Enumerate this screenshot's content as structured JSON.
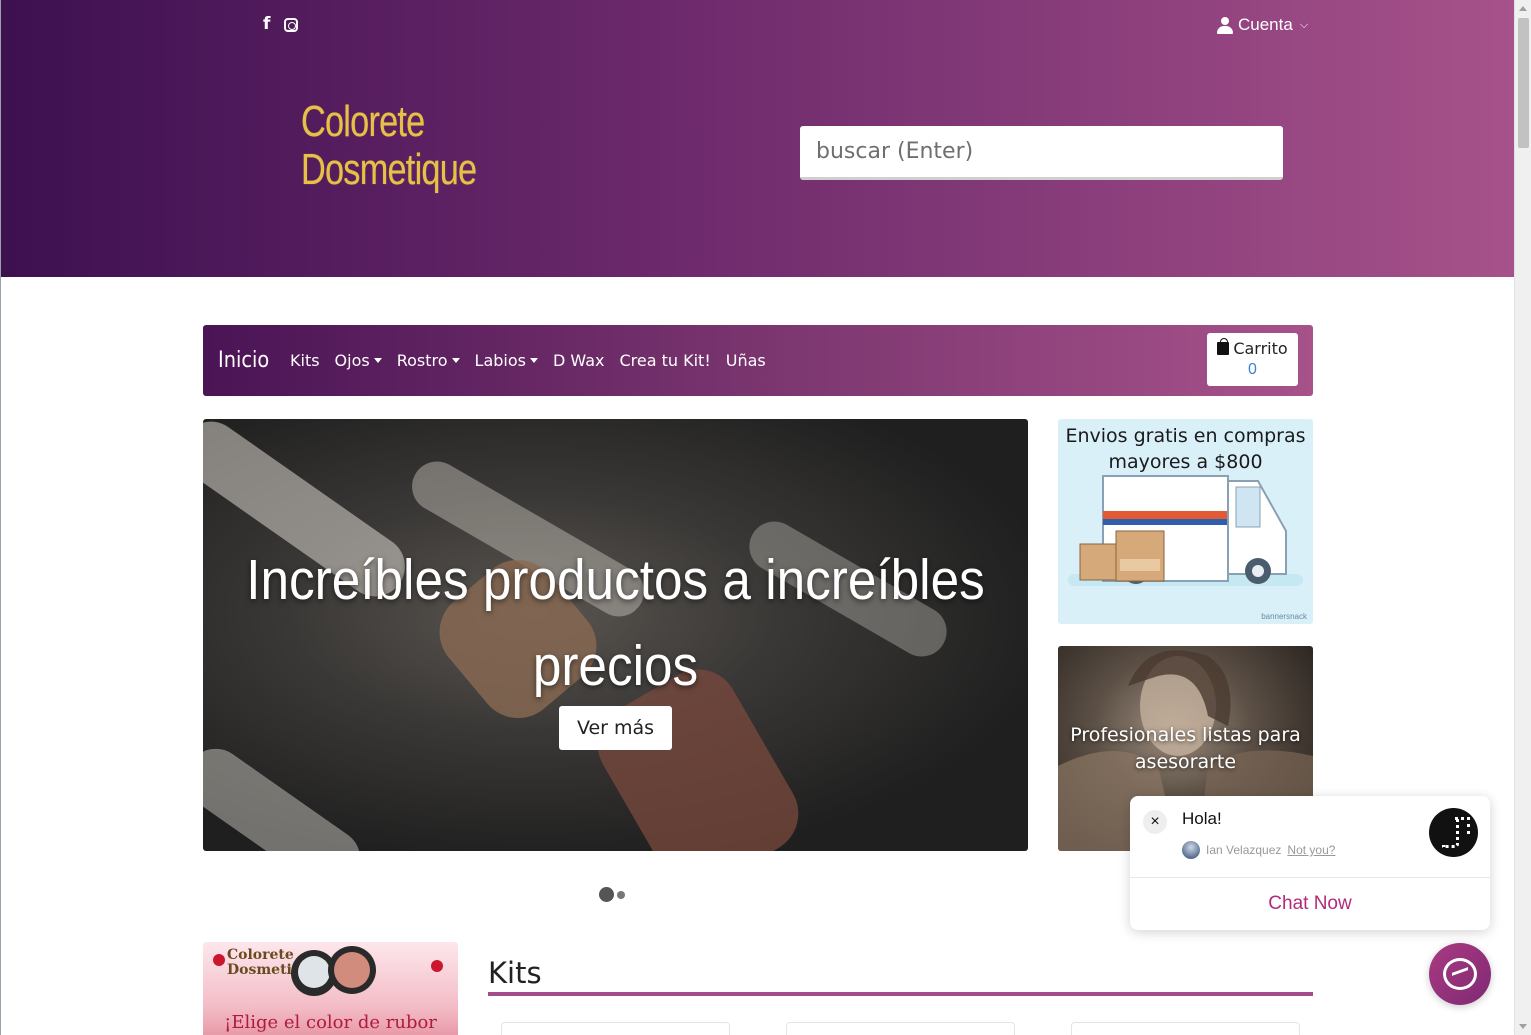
{
  "header": {
    "social": {
      "facebook_icon": "facebook-f-icon",
      "instagram_icon": "instagram-icon"
    },
    "account_label": "Cuenta",
    "logo_line1": "Colorete",
    "logo_line2": "Dosmetique",
    "search_placeholder": "buscar (Enter)"
  },
  "nav": {
    "brand": "Inicio",
    "items": [
      {
        "label": "Kits",
        "dropdown": false
      },
      {
        "label": "Ojos",
        "dropdown": true
      },
      {
        "label": "Rostro",
        "dropdown": true
      },
      {
        "label": "Labios",
        "dropdown": true
      },
      {
        "label": "D Wax",
        "dropdown": false
      },
      {
        "label": "Crea tu Kit!",
        "dropdown": false
      },
      {
        "label": "Uñas",
        "dropdown": false
      }
    ],
    "cart_label": "Carrito",
    "cart_count": "0"
  },
  "hero": {
    "headline": "Increíbles productos a increíbles precios",
    "button": "Ver más",
    "slides": 2,
    "active_slide": 1
  },
  "promo": {
    "text": "Envios gratis en compras mayores a $800",
    "tag": "bannersnack"
  },
  "pro_banner": {
    "text": "Profesionales listas para asesorarte"
  },
  "blush_banner": {
    "logo_line1": "Colorete",
    "logo_line2": "Dosmetique",
    "caption": "¡Elige el color de rubor"
  },
  "kits_section": {
    "title": "Kits"
  },
  "chat": {
    "greeting": "Hola!",
    "agent_name": "Ian Velazquez",
    "not_you": "Not you?",
    "cta": "Chat Now",
    "close": "×"
  },
  "colors": {
    "accent": "#a34d88",
    "header_start": "#3d1050",
    "header_end": "#a7528a",
    "chat_cta": "#b22b7b",
    "logo_gold": "#e7c04a"
  }
}
